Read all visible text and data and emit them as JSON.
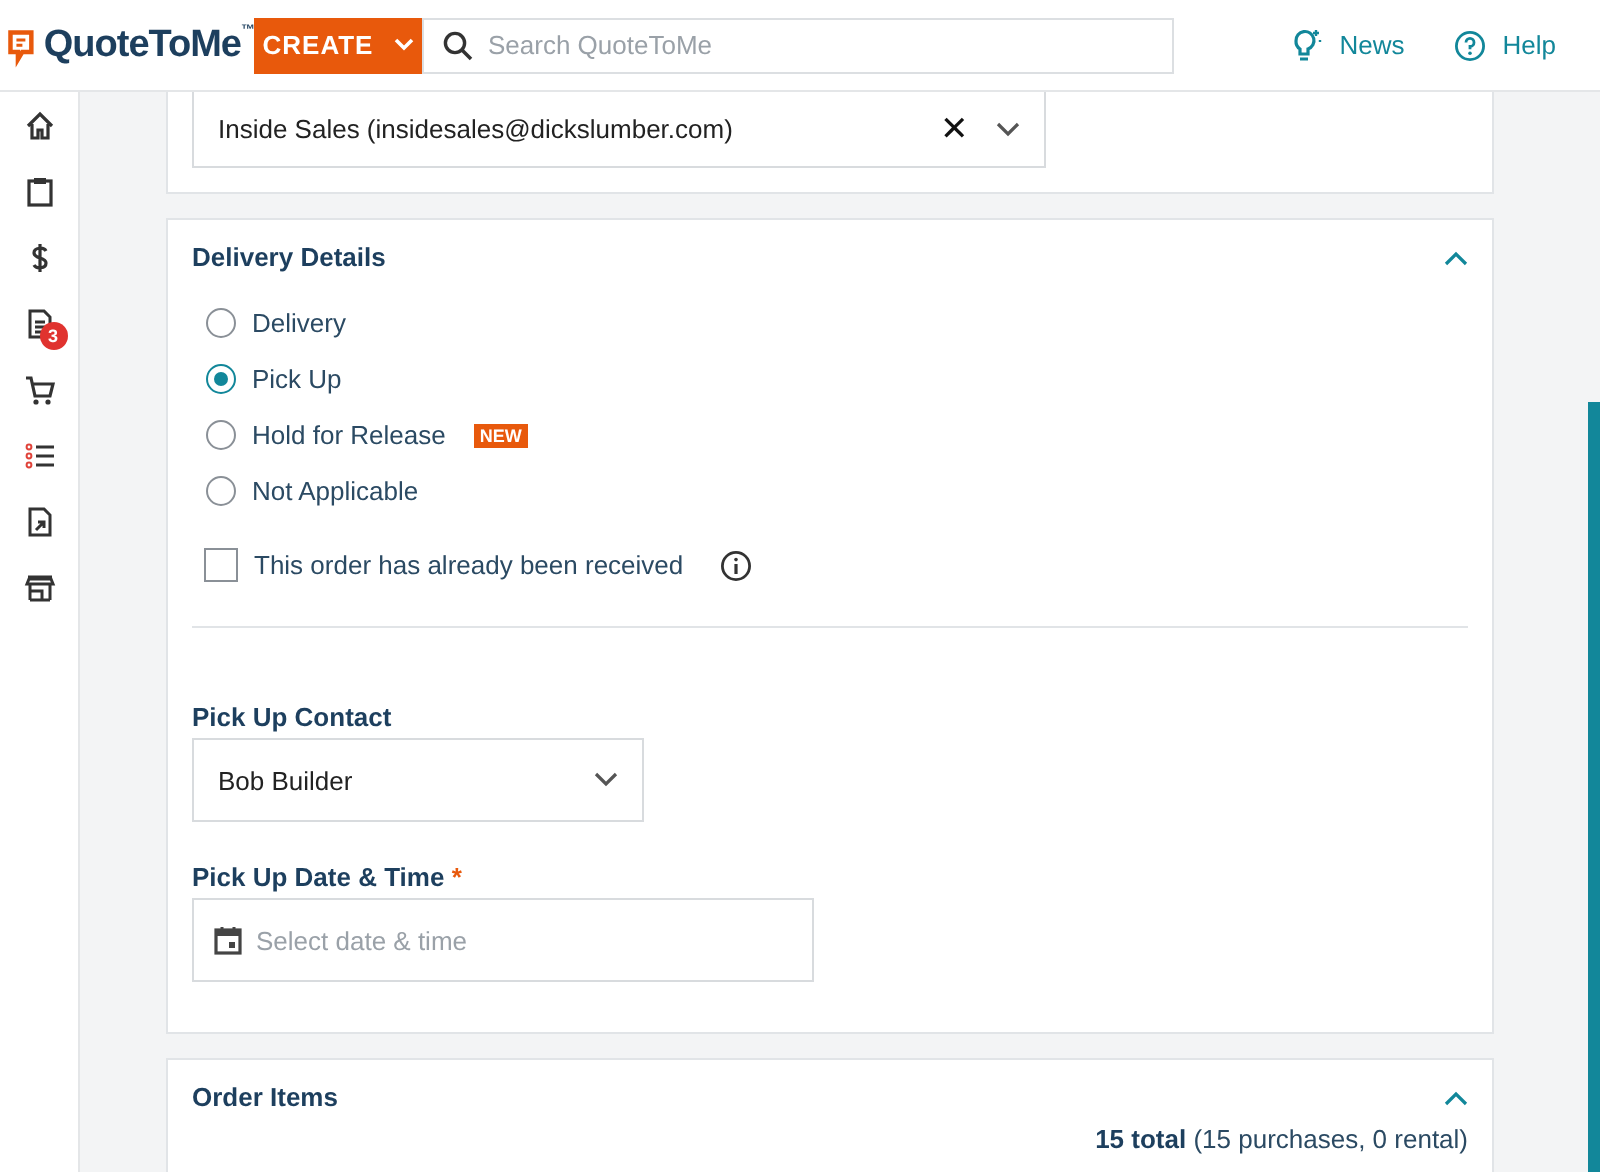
{
  "header": {
    "logo": "QuoteToMe",
    "logo_mark": "™",
    "create_button": "CREATE",
    "search": {
      "placeholder": "Search QuoteToMe"
    },
    "links": [
      "News",
      "Help"
    ]
  },
  "sidebar": {
    "badge": "3"
  },
  "contact_select": {
    "value": "Inside Sales (insidesales@dickslumber.com)",
    "clear": "✕"
  },
  "delivery": {
    "title": "Delivery Details",
    "expanded": true,
    "options": [
      {
        "label": "Delivery",
        "selected": false
      },
      {
        "label": "Pick Up",
        "selected": true
      },
      {
        "label": "Hold for Release",
        "selected": false,
        "badge": "NEW"
      },
      {
        "label": "Not Applicable",
        "selected": false
      }
    ],
    "received": {
      "label": "This order has already been received",
      "checked": false
    },
    "pickup_contact": {
      "label": "Pick Up Contact",
      "value": "Bob Builder"
    },
    "pickup_date": {
      "label": "Pick Up Date & Time",
      "required_mark": "*",
      "placeholder": "Select date & time"
    }
  },
  "order_items": {
    "title": "Order Items",
    "expanded": true,
    "summary": "**15 total** (15 purchases, 0 rental)"
  }
}
